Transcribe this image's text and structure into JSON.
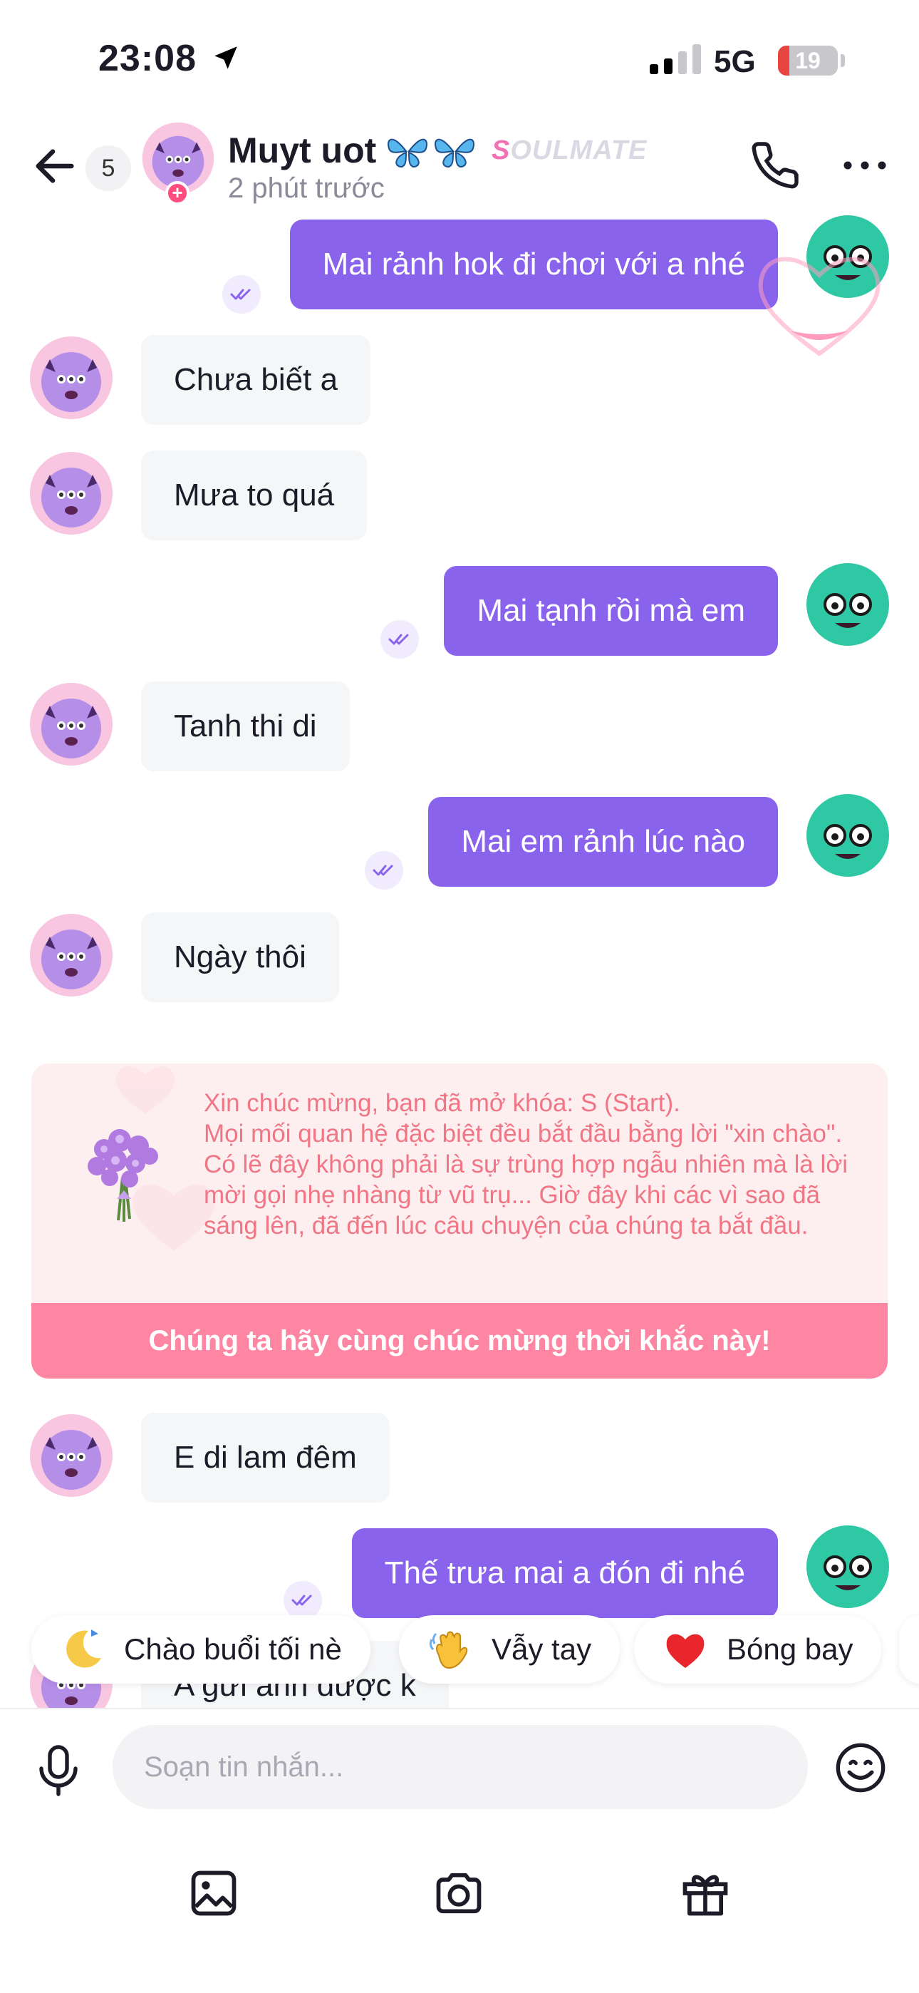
{
  "status_bar": {
    "time": "23:08",
    "network": "5G",
    "battery": "19",
    "battery_level_percent": 19
  },
  "header": {
    "unread_count": "5",
    "contact_name": "Muyt uot",
    "name_emoji": "🦋🦋",
    "tag_initial": "S",
    "tag_rest": "OULMATE",
    "last_seen": "2 phút trước"
  },
  "colors": {
    "outgoing_bubble": "#8a63ec",
    "incoming_bubble": "#f5f6f8",
    "accent_pink": "#ff86a3",
    "congrats_text": "#f07686",
    "congrats_bg": "#fdeff0"
  },
  "messages": [
    {
      "side": "out",
      "text": "Mai rảnh hok đi chơi với a nhé"
    },
    {
      "side": "in",
      "text": "Chưa biết a"
    },
    {
      "side": "in",
      "text": "Mưa to quá"
    },
    {
      "side": "out",
      "text": "Mai tạnh rồi mà em"
    },
    {
      "side": "in",
      "text": "Tanh thi di"
    },
    {
      "side": "out",
      "text": "Mai em rảnh lúc nào"
    },
    {
      "side": "in",
      "text": "Ngày thôi"
    },
    {
      "side": "in",
      "text": "E di lam đêm"
    },
    {
      "side": "out",
      "text": "Thế trưa mai a đón đi nhé"
    },
    {
      "side": "in",
      "text": "A gửi anh được k"
    }
  ],
  "congrats_card": {
    "lines": [
      "Xin chúc mừng, bạn đã mở khóa: S (Start).",
      "Mọi mối quan hệ đặc biệt đều bắt đầu bằng lời \"xin chào\". Có lẽ đây không phải là sự trùng hợp ngẫu nhiên mà là lời mời gọi nhẹ nhàng từ vũ trụ... Giờ đây khi các vì sao đã sáng lên, đã đến lúc câu chuyện của chúng ta bắt đầu."
    ],
    "cta": "Chúng ta hãy cùng chúc mừng thời khắc này!"
  },
  "quick_replies": [
    {
      "emoji": "🌙",
      "label": "Chào buổi tối nè"
    },
    {
      "emoji": "👋",
      "label": "Vẫy tay"
    },
    {
      "emoji": "❤️",
      "label": "Bóng bay"
    }
  ],
  "composer": {
    "placeholder": "Soạn tin nhắn..."
  },
  "icons": [
    "back-arrow-icon",
    "phone-icon",
    "more-icon",
    "microphone-icon",
    "emoji-icon",
    "image-icon",
    "camera-icon",
    "gift-icon",
    "read-receipt-icon",
    "location-arrow-icon",
    "signal-icon"
  ]
}
